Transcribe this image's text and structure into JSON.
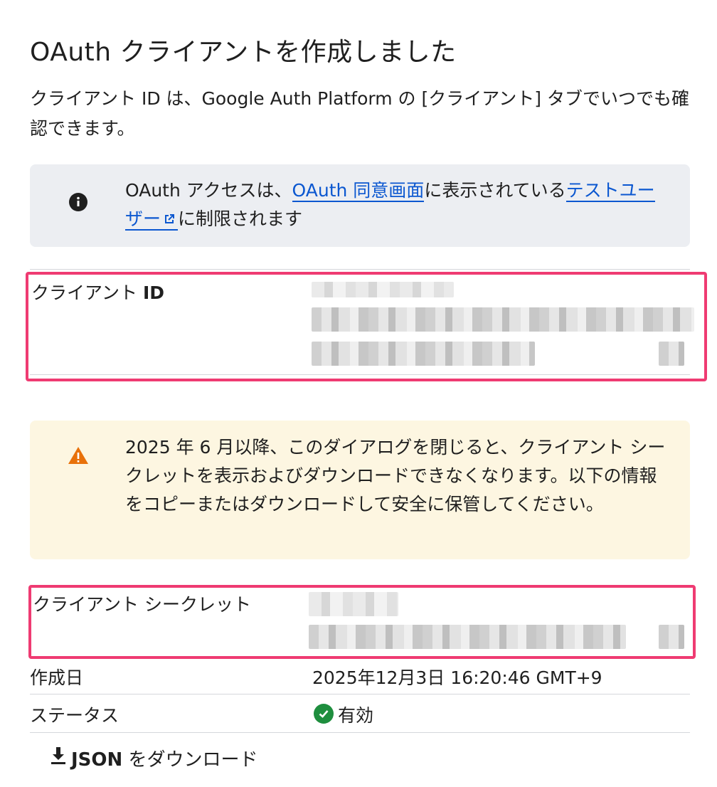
{
  "dialog": {
    "title": "OAuth クライアントを作成しました",
    "description": "クライアント ID は、Google Auth Platform の [クライアント] タブでいつでも確認できます。"
  },
  "info_notice": {
    "icon": "info-icon",
    "text_before": "OAuth アクセスは、",
    "link_consent": "OAuth 同意画面",
    "text_middle": "に表示されている",
    "link_test_users": "テストユーザー",
    "text_after": "に制限されます"
  },
  "client_id": {
    "label_prefix": "クライアント ",
    "label_bold": "ID"
  },
  "warning_notice": {
    "icon": "warning-icon",
    "text": "2025 年 6 月以降、このダイアログを閉じると、クライアント シークレットを表示およびダウンロードできなくなります。以下の情報をコピーまたはダウンロードして安全に保管してください。"
  },
  "client_secret": {
    "label": "クライアント シークレット"
  },
  "created": {
    "label": "作成日",
    "value": "2025年12月3日 16:20:46 GMT+9"
  },
  "status": {
    "label": "ステータス",
    "value": "有効",
    "color": "#1e8e3e"
  },
  "download": {
    "json_label": "JSON",
    "suffix_label": " をダウンロード"
  },
  "colors": {
    "link": "#0b57d0",
    "highlight_frame": "#ef3b72",
    "info_bg": "#eceef2",
    "warning_bg": "#fdf6e1",
    "warning_icon": "#e8710a"
  }
}
